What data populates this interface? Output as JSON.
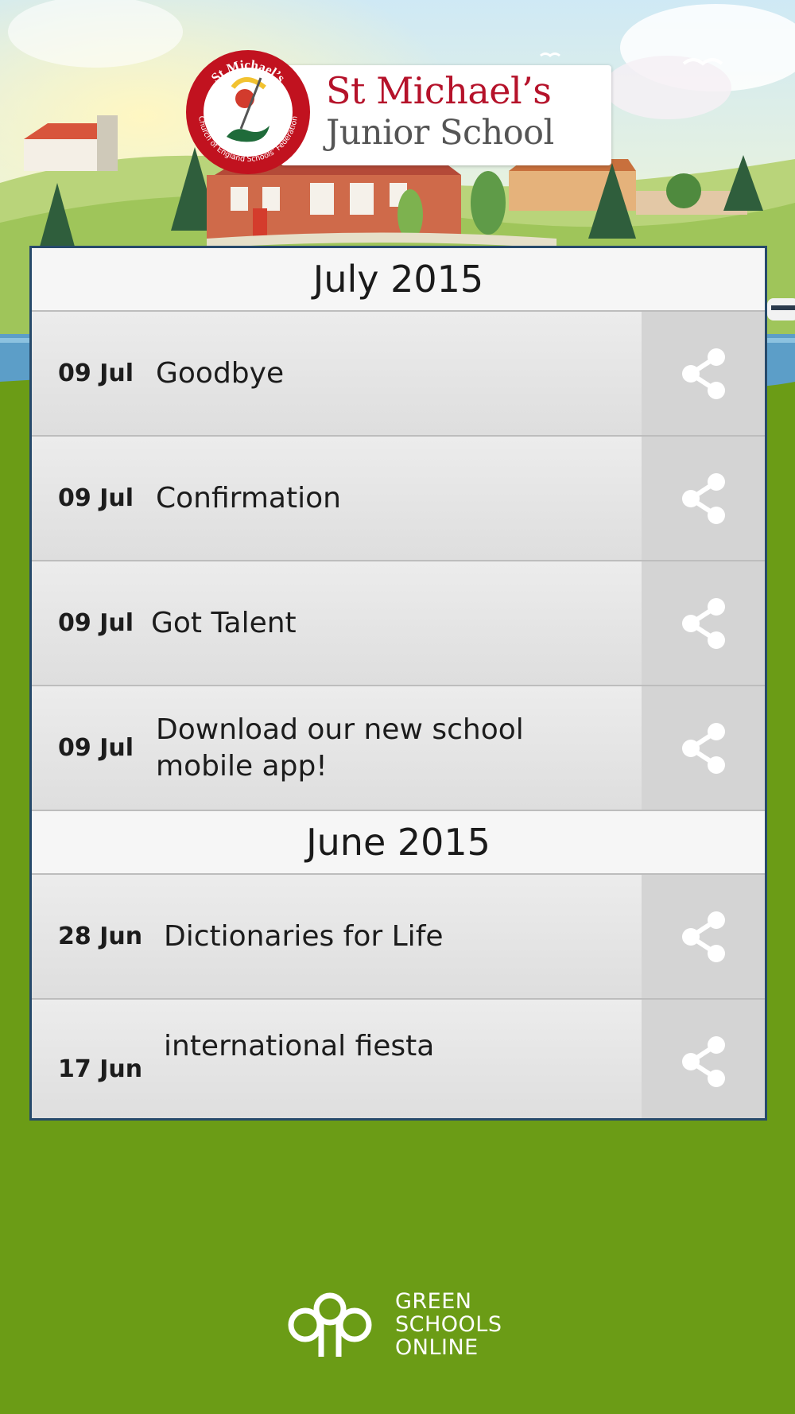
{
  "header": {
    "school_name_line1": "St Michael’s",
    "school_name_line2": "Junior School",
    "crest_text": "St Michael’s Church of England Schools’ Federation"
  },
  "news": {
    "sections": [
      {
        "month": "July 2015",
        "items": [
          {
            "date": "09 Jul",
            "title": "Goodbye"
          },
          {
            "date": "09 Jul",
            "title": "Confirmation"
          },
          {
            "date": "09 Jul",
            "title": "Got Talent"
          },
          {
            "date": "09 Jul",
            "title": "Download our new school mobile app!"
          }
        ]
      },
      {
        "month": "June 2015",
        "items": [
          {
            "date": "28 Jun",
            "title": "Dictionaries for Life"
          },
          {
            "date": "17 Jun",
            "title": "international fiesta"
          }
        ]
      }
    ],
    "share_icon": "share-icon"
  },
  "footer": {
    "brand_line1": "GREEN",
    "brand_line2": "SCHOOLS",
    "brand_line3": "ONLINE"
  },
  "colors": {
    "background_green": "#6b9c16",
    "panel_border": "#274a6b",
    "school_red": "#b5122a"
  }
}
